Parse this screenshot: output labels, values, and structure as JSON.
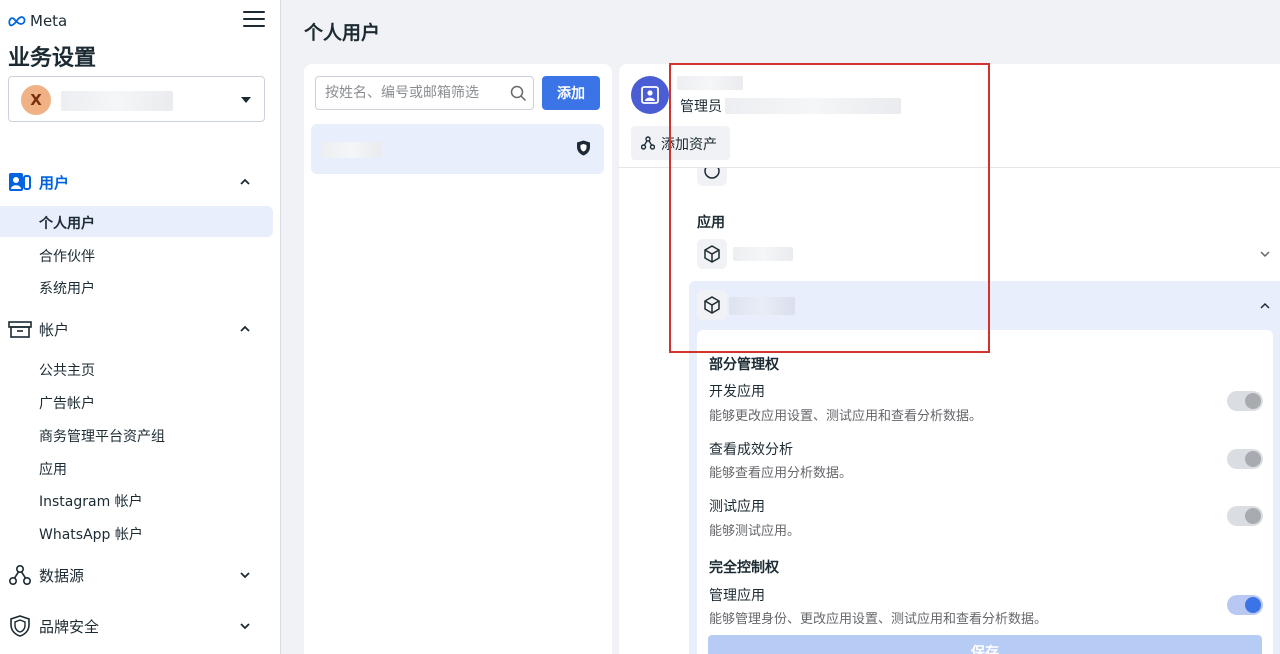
{
  "brand": {
    "name": "Meta"
  },
  "sidebar": {
    "title": "业务设置",
    "account": {
      "avatar_letter": "X"
    },
    "sections": [
      {
        "label": "用户",
        "items": [
          "个人用户",
          "合作伙伴",
          "系统用户"
        ]
      },
      {
        "label": "帐户",
        "items": [
          "公共主页",
          "广告帐户",
          "商务管理平台资产组",
          "应用",
          "Instagram 帐户",
          "WhatsApp 帐户"
        ]
      },
      {
        "label": "数据源"
      },
      {
        "label": "品牌安全"
      }
    ],
    "selected_item": "个人用户"
  },
  "main": {
    "page_title": "个人用户",
    "search": {
      "placeholder": "按姓名、编号或邮箱筛选"
    },
    "add_button": "添加"
  },
  "detail": {
    "role": "管理员",
    "add_asset_button": "添加资产",
    "apps_heading": "应用",
    "permissions": {
      "partial_heading": "部分管理权",
      "partial": [
        {
          "title": "开发应用",
          "desc": "能够更改应用设置、测试应用和查看分析数据。",
          "enabled": false
        },
        {
          "title": "查看成效分析",
          "desc": "能够查看应用分析数据。",
          "enabled": false
        },
        {
          "title": "测试应用",
          "desc": "能够测试应用。",
          "enabled": false
        }
      ],
      "full_heading": "完全控制权",
      "full": [
        {
          "title": "管理应用",
          "desc": "能够管理身份、更改应用设置、测试应用和查看分析数据。",
          "enabled": true
        }
      ]
    },
    "save_button": "保存"
  },
  "colors": {
    "accent": "#3b74e6",
    "selected_bg": "#e8eefb",
    "highlight": "#d0342c"
  },
  "icons": [
    "meta-logo-icon",
    "hamburger-icon",
    "users-icon",
    "briefcase-icon",
    "data-sources-icon",
    "brand-safety-icon",
    "search-icon",
    "shield-icon",
    "user-avatar-icon",
    "add-asset-icon",
    "app-cube-icon",
    "chevron-up-icon",
    "chevron-down-icon"
  ]
}
